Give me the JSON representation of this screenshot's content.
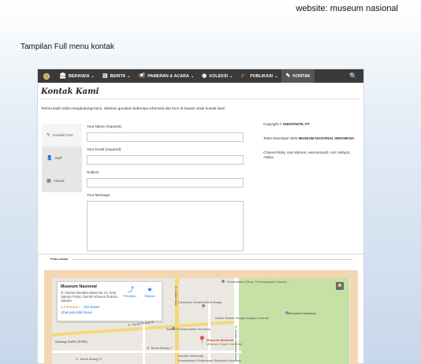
{
  "header": {
    "website_label": "website: museum nasional"
  },
  "slide": {
    "caption": "Tampilan Full menu kontak"
  },
  "nav": {
    "items": [
      {
        "label": "BERANDA",
        "icon": "🏛",
        "icon_name": "museum-icon",
        "caret": "⌄",
        "active": false
      },
      {
        "label": "BERITA",
        "icon": "▤",
        "icon_name": "newspaper-icon",
        "caret": "⌄",
        "active": false
      },
      {
        "label": "PAMERAN & ACARA",
        "icon": "📢",
        "icon_name": "megaphone-icon",
        "caret": "⌄",
        "active": false
      },
      {
        "label": "KOLEKSI",
        "icon": "◉",
        "icon_name": "circle-icon",
        "caret": "⌄",
        "active": false
      },
      {
        "label": "PUBLIKASI",
        "icon": "🎓",
        "icon_name": "graduation-cap-icon",
        "caret": "⌄",
        "active": false
      },
      {
        "label": "KONTAK",
        "icon": "✎",
        "icon_name": "edit-icon",
        "caret": "",
        "active": true
      }
    ],
    "search_icon": "🔍"
  },
  "page": {
    "title": "Kontak Kami",
    "intro": "Terima kasih telah menghubungi kami, silahkan gunakan beberapa informasi dan form di bawah untuk kontak kami"
  },
  "tabs": [
    {
      "label": "Kontak Form",
      "icon": "✎",
      "icon_name": "pencil-icon",
      "active": true
    },
    {
      "label": "Staff",
      "icon": "👤",
      "icon_name": "user-icon",
      "active": false
    },
    {
      "label": "Alamat",
      "icon": "▦",
      "icon_name": "building-icon",
      "active": false
    }
  ],
  "form": {
    "name_label": "Your Name (required)",
    "email_label": "Your Email (required)",
    "subject_label": "Subject",
    "message_label": "Your Message"
  },
  "side_info": {
    "copyright_prefix": "Copyright © ",
    "copyright_company": "INDOFINITE, PT",
    "team_prefix": "Team Developer Web ",
    "team_name": "MUSEUM NASIONAL INDONESIA",
    "developers": "Chaerul Rizky, Ivan Borneo, Hermansyah, Aris Hidayat, Aditya."
  },
  "map_section": {
    "label": "Peta Lokasi"
  },
  "map_card": {
    "title": "Museum Nasional",
    "address": "Jl. Medan Merdeka Barat No.12, Kota Jakarta Pusat, Daerah Khusus Ibukota Jakarta",
    "rating": "4,4",
    "stars": "★★★★☆",
    "reviews": "316 ulasan",
    "link": "Lihat peta lebih besar",
    "directions_label": "Petunjuk...",
    "save_label": "Simpan"
  },
  "map_labels": {
    "kementerian_desa": "Kementerian Desa, Pembangunan Daerah...",
    "dirjen_bina_marga": "Direktorat Jenderal Bina Marga",
    "kantor_bpbd": "Kantor Badan Pengembangan Daerah",
    "badan_perkoperasian": "Badan Perkoperasian Solutions",
    "gedung_guru": "Gedung GURU (PGRI)",
    "museum_nasional": "Museum Nasional",
    "museum_gajah": "Museum Gajah Indonesia",
    "monumen_nasional": "Monumen Nasional",
    "mandiri_university": "Mandiri University",
    "kementerian_pertahanan": "Kementerian Pertahanan Republik Indonesia",
    "jl_tanah_abang_3": "Jl. Tanah Abang III",
    "jl_tanah_abang_2": "Jl. Tanah Abang II",
    "jl_tanah_abang_4": "Jl. Tanah Abang IV",
    "jl_abdul_muis": "Jl. Abdul Muis",
    "jl_medan_merdeka": "Jl. Medan Merdeka Barat"
  },
  "colors": {
    "navbar": "#3a3a3a",
    "nav_active": "#555555",
    "map_frame": "#f2d7b2",
    "park": "#c7e0a6",
    "pin": "#db3b2b",
    "link": "#1a73e8"
  }
}
